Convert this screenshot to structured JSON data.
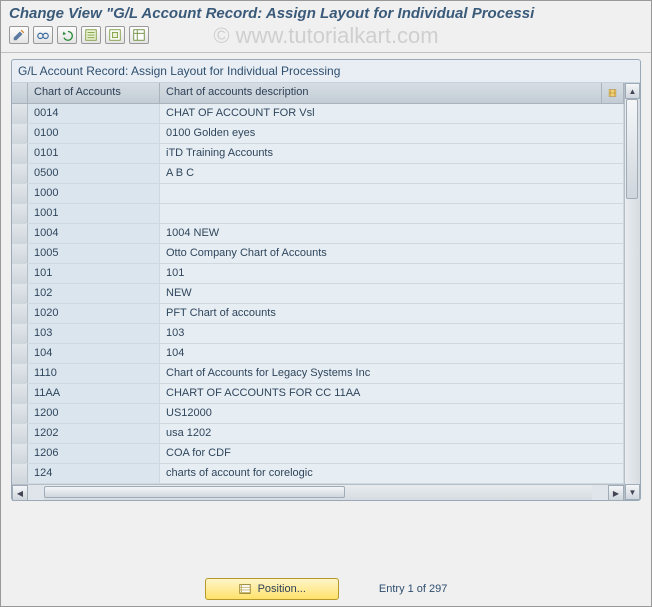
{
  "title": "Change View \"G/L Account Record: Assign Layout for Individual Processi",
  "watermark": "© www.tutorialkart.com",
  "toolbar": {
    "icons": [
      "change-icon",
      "spectacles-icon",
      "undo-icon",
      "select-all-icon",
      "deselect-all-icon",
      "table-settings-icon"
    ]
  },
  "panel": {
    "header": "G/L Account Record: Assign Layout for Individual Processing",
    "columns": {
      "coa": "Chart of Accounts",
      "desc": "Chart of accounts description"
    },
    "rows": [
      {
        "coa": "0014",
        "desc": "CHAT OF ACCOUNT FOR Vsl"
      },
      {
        "coa": "0100",
        "desc": "0100 Golden eyes"
      },
      {
        "coa": "0101",
        "desc": "iTD Training Accounts"
      },
      {
        "coa": "0500",
        "desc": "A B C"
      },
      {
        "coa": "1000",
        "desc": ""
      },
      {
        "coa": "1001",
        "desc": ""
      },
      {
        "coa": "1004",
        "desc": "1004 NEW"
      },
      {
        "coa": "1005",
        "desc": "Otto Company Chart of Accounts"
      },
      {
        "coa": "101",
        "desc": "101"
      },
      {
        "coa": "102",
        "desc": "NEW"
      },
      {
        "coa": "1020",
        "desc": "PFT Chart of accounts"
      },
      {
        "coa": "103",
        "desc": "103"
      },
      {
        "coa": "104",
        "desc": "104"
      },
      {
        "coa": "1110",
        "desc": "Chart of Accounts for Legacy Systems Inc"
      },
      {
        "coa": "11AA",
        "desc": "CHART OF ACCOUNTS FOR CC 11AA"
      },
      {
        "coa": "1200",
        "desc": "US12000"
      },
      {
        "coa": "1202",
        "desc": "usa 1202"
      },
      {
        "coa": "1206",
        "desc": "COA for CDF"
      },
      {
        "coa": "124",
        "desc": "charts of account for corelogic"
      }
    ]
  },
  "footer": {
    "position_label": "Position...",
    "entry_text": "Entry 1 of 297"
  }
}
